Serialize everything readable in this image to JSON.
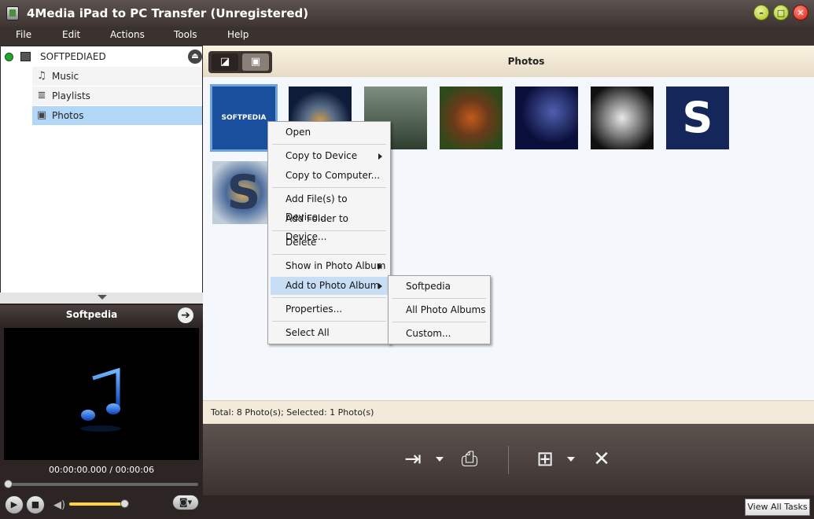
{
  "window": {
    "title": "4Media iPad to PC Transfer (Unregistered)",
    "minimize": "–",
    "restore": "□",
    "close": "✕"
  },
  "menubar": [
    "File",
    "Edit",
    "Actions",
    "Tools",
    "Help"
  ],
  "tree": {
    "device": "SOFTPEDIAED",
    "items": [
      {
        "label": "Music",
        "icon": "music-note-icon",
        "glyph": "♫"
      },
      {
        "label": "Playlists",
        "icon": "playlist-icon",
        "glyph": "≣"
      },
      {
        "label": "Photos",
        "icon": "photo-icon",
        "glyph": "▣"
      }
    ],
    "selected": "Photos"
  },
  "player": {
    "title": "Softpedia",
    "time": "00:00:00.000 / 00:00:06",
    "play_glyph": "▶",
    "stop_glyph": "■",
    "speaker_glyph": "◀)",
    "snapshot_glyph": "◙▾",
    "arrow_glyph": "➔",
    "volume_fraction": 0.95,
    "seek_fraction": 0.0
  },
  "section": {
    "title": "Photos"
  },
  "view_toggle": {
    "btn1": "◪",
    "btn2": "▣"
  },
  "thumbnails": [
    {
      "name": "thumb-softpedia-logo",
      "text": "SOFTPEDIA",
      "selected": true
    },
    {
      "name": "thumb-swirl",
      "text": ""
    },
    {
      "name": "thumb-forest",
      "text": ""
    },
    {
      "name": "thumb-leaves",
      "text": ""
    },
    {
      "name": "thumb-blue-abstract",
      "text": ""
    },
    {
      "name": "thumb-crystal",
      "text": ""
    },
    {
      "name": "thumb-s-logo",
      "text": "S"
    },
    {
      "name": "thumb-s-swirl",
      "text": "S"
    }
  ],
  "status": {
    "text": "Total: 8 Photo(s); Selected: 1 Photo(s)"
  },
  "toolbar": {
    "import_glyph": "⇥",
    "export_glyph": "⎙",
    "add_glyph": "⊞",
    "delete_glyph": "✕"
  },
  "view_all_tasks": "View All Tasks",
  "context_menu": {
    "items": [
      "Open",
      "Copy to Device",
      "Copy to Computer...",
      "Add File(s) to Device...",
      "Add Folder to Device...",
      "Delete",
      "Show in Photo Album",
      "Add to Photo Album",
      "Properties...",
      "Select All"
    ],
    "hovered": "Add to Photo Album"
  },
  "submenu": {
    "items": [
      "Softpedia",
      "All Photo Albums",
      "Custom..."
    ]
  },
  "colors": {
    "selection": "#b2d6f6",
    "hover": "#c7def5",
    "volume": "#ffd33a",
    "note": "#1b6cf5"
  }
}
